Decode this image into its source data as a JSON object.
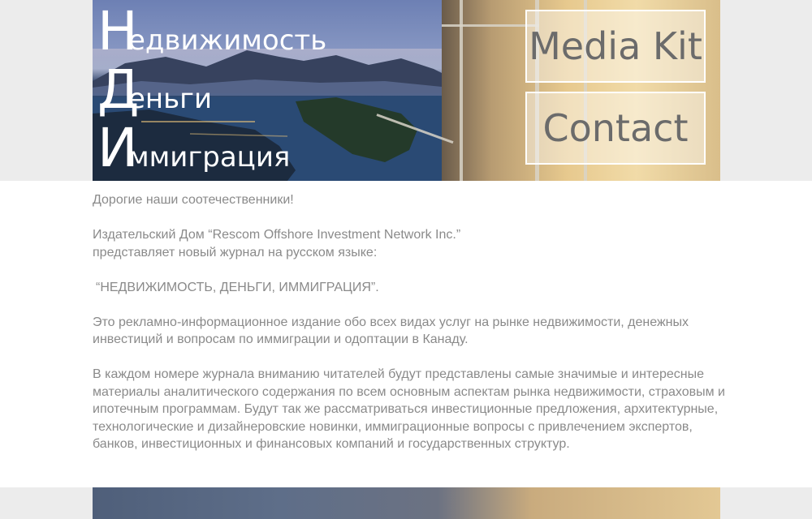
{
  "header": {
    "brand": [
      {
        "cap": "Н",
        "rest": "едвижимость"
      },
      {
        "cap": "Д",
        "rest": "еньги"
      },
      {
        "cap": "И",
        "rest": "ммиграция"
      }
    ],
    "buttons": {
      "media_kit": "Media Kit",
      "contact": "Contact"
    }
  },
  "content": {
    "greeting": "Дорогие наши соотечественники!",
    "intro_line1": "Издательский Дом “Rescom Offshore Investment Network Inc.”",
    "intro_line2": "представляет новый журнал на русском языке:",
    "title_quote": "“НЕДВИЖИМОСТЬ, ДЕНЬГИ, ИММИГРАЦИЯ”.",
    "para1": "Это рекламно-информационное издание обо всех видах услуг на рынке недвижимости, денежных инвестиций и вопросам по иммиграции и одоптации в Канаду.",
    "para2": "В каждом номере журнала вниманию читателей будут представлены самые значимые и интересные материалы аналитического содержания по всем основным аспектам рынка недвижимости, страховым и ипотечным программам. Будут так же рассматриваться инвестиционные предложения, архитектурные, технологические и дизайнеровские новинки, иммиграционные вопросы с привлечением экспертов, банков, инвестиционных и финансовых компаний и государственных структур."
  }
}
